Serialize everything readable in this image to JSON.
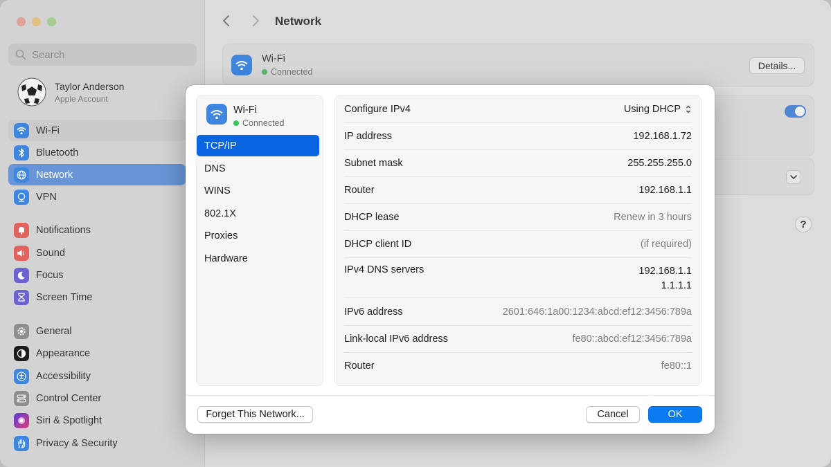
{
  "sidebar": {
    "search_placeholder": "Search",
    "account": {
      "name": "Taylor Anderson",
      "subtitle": "Apple Account"
    },
    "items": [
      {
        "label": "Wi-Fi",
        "icon": "wifi-icon",
        "color": "#3e86de"
      },
      {
        "label": "Bluetooth",
        "icon": "bluetooth-icon",
        "color": "#3e86de"
      },
      {
        "label": "Network",
        "icon": "globe-icon",
        "color": "#3e86de"
      },
      {
        "label": "VPN",
        "icon": "vpn-icon",
        "color": "#3e86de"
      },
      {
        "label": "Notifications",
        "icon": "bell-icon",
        "color": "#e2625d"
      },
      {
        "label": "Sound",
        "icon": "speaker-icon",
        "color": "#e2625d"
      },
      {
        "label": "Focus",
        "icon": "moon-icon",
        "color": "#6a63d0"
      },
      {
        "label": "Screen Time",
        "icon": "hourglass-icon",
        "color": "#6a63d0"
      },
      {
        "label": "General",
        "icon": "gear-icon",
        "color": "#8e8e93"
      },
      {
        "label": "Appearance",
        "icon": "appearance-icon",
        "color": "#1d1d1f"
      },
      {
        "label": "Accessibility",
        "icon": "accessibility-icon",
        "color": "#3e86de"
      },
      {
        "label": "Control Center",
        "icon": "control-center-icon",
        "color": "#8e8e93"
      },
      {
        "label": "Siri & Spotlight",
        "icon": "siri-icon",
        "color": "#9b59b6"
      },
      {
        "label": "Privacy & Security",
        "icon": "hand-icon",
        "color": "#3e86de"
      }
    ]
  },
  "main": {
    "title": "Network",
    "wifi_card": {
      "name": "Wi-Fi",
      "status": "Connected",
      "details_label": "Details..."
    },
    "help_label": "?"
  },
  "modal": {
    "network": {
      "name": "Wi-Fi",
      "status": "Connected"
    },
    "tabs": [
      "TCP/IP",
      "DNS",
      "WINS",
      "802.1X",
      "Proxies",
      "Hardware"
    ],
    "active_tab": "TCP/IP",
    "rows": [
      {
        "label": "Configure IPv4",
        "value": "Using DHCP"
      },
      {
        "label": "IP address",
        "value": "192.168.1.72"
      },
      {
        "label": "Subnet mask",
        "value": "255.255.255.0"
      },
      {
        "label": "Router",
        "value": "192.168.1.1"
      },
      {
        "label": "DHCP lease",
        "value": "Renew in 3 hours"
      },
      {
        "label": "DHCP client ID",
        "value": "(if required)"
      },
      {
        "label": "IPv4 DNS servers",
        "values": [
          "192.168.1.1",
          "1.1.1.1"
        ]
      },
      {
        "label": "IPv6 address",
        "value": "2601:646:1a00:1234:abcd:ef12:3456:789a"
      },
      {
        "label": "Link-local IPv6 address",
        "value": "fe80::abcd:ef12:3456:789a"
      },
      {
        "label": "Router",
        "value": "fe80::1"
      }
    ],
    "buttons": {
      "forget": "Forget This Network...",
      "cancel": "Cancel",
      "ok": "OK"
    }
  },
  "colors": {
    "accent": "#0a7bf0",
    "selection": "#0a66e0",
    "connected": "#34c759"
  }
}
